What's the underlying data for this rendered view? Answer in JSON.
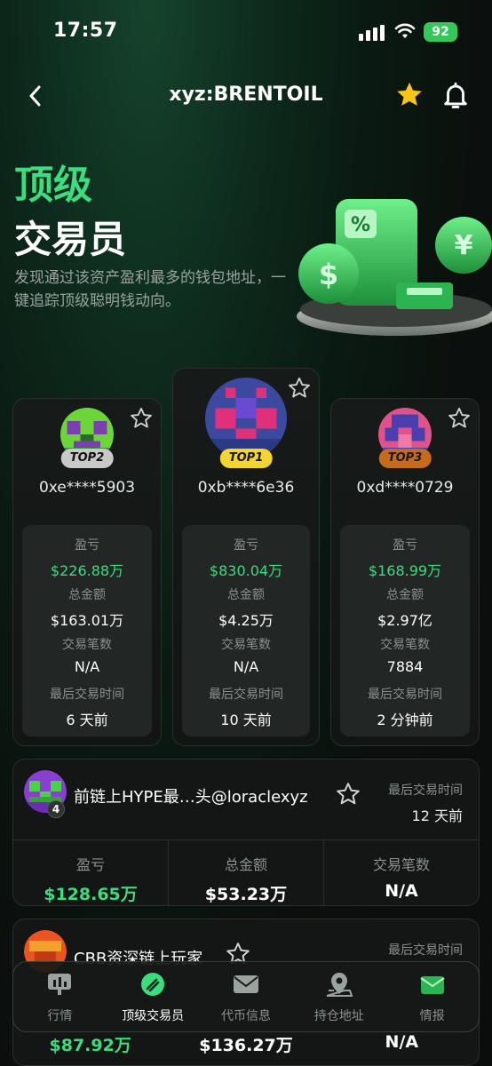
{
  "status_bar": {
    "time": "17:57",
    "battery": "92"
  },
  "nav": {
    "title": "xyz:BRENTOIL"
  },
  "hero": {
    "title_line1": "顶级",
    "title_line2": "交易员",
    "description": "发现通过该资产盈利最多的钱包地址，一键追踪顶级聪明钱动向。"
  },
  "labels": {
    "pnl": "盈亏",
    "total_amount": "总金额",
    "trade_count": "交易笔数",
    "last_trade_time": "最后交易时间"
  },
  "top_traders": [
    {
      "rank_badge": "TOP2",
      "address": "0xe****5903",
      "pnl": "$226.88万",
      "total": "$163.01万",
      "trades": "N/A",
      "last_trade": "6 天前",
      "badge_color": "#c9c9c9"
    },
    {
      "rank_badge": "TOP1",
      "address": "0xb****6e36",
      "pnl": "$830.04万",
      "total": "$4.25万",
      "trades": "N/A",
      "last_trade": "10 天前",
      "badge_color": "#f2d52f"
    },
    {
      "rank_badge": "TOP3",
      "address": "0xd****0729",
      "pnl": "$168.99万",
      "total": "$2.97亿",
      "trades": "7884",
      "last_trade": "2 分钟前",
      "badge_color": "#c46b1d"
    }
  ],
  "list_traders": [
    {
      "rank": "4",
      "name": "前链上HYPE最…头@loraclexyz",
      "last_trade": "12 天前",
      "pnl": "$128.65万",
      "total": "$53.23万",
      "trades": "N/A"
    },
    {
      "rank": "",
      "name": "CBB资深链上玩家",
      "last_trade": "",
      "pnl": "$87.92万",
      "total": "$136.27万",
      "trades": "N/A"
    }
  ],
  "tabs": [
    {
      "label": "行情",
      "icon": "chart-bar-icon",
      "active": false
    },
    {
      "label": "顶级交易员",
      "icon": "trader-icon",
      "active": true
    },
    {
      "label": "代币信息",
      "icon": "mail-icon",
      "active": false
    },
    {
      "label": "持仓地址",
      "icon": "map-pin-icon",
      "active": false
    },
    {
      "label": "情报",
      "icon": "news-icon",
      "active": false
    }
  ],
  "colors": {
    "accent": "#3ddc7e",
    "background": "#0b0d0c"
  }
}
